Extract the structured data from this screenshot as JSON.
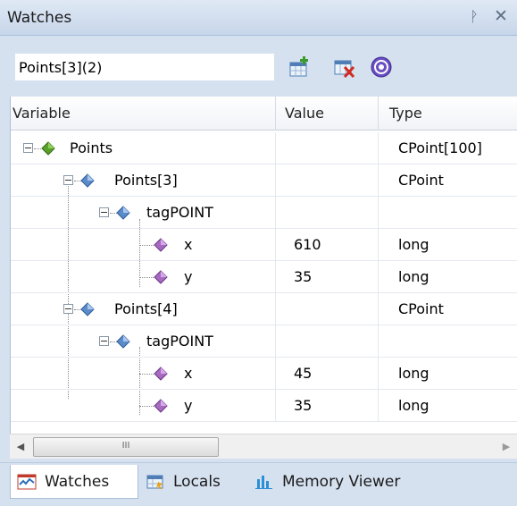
{
  "window": {
    "title": "Watches",
    "pin_glyph": "ᚹ",
    "close_glyph": "✕"
  },
  "toolbar": {
    "expression_value": "Points[3](2)",
    "buttons": [
      {
        "icon": "add-watch-icon"
      },
      {
        "icon": "delete-watch-icon"
      },
      {
        "icon": "help-icon"
      }
    ]
  },
  "grid": {
    "columns": [
      "Variable",
      "Value",
      "Type"
    ],
    "rows": [
      {
        "name": "Points",
        "value": "",
        "type": "CPoint[100]",
        "icon": "green-diamond-icon",
        "expander": "minus"
      },
      {
        "name": "Points[3]",
        "value": "",
        "type": "CPoint",
        "icon": "blue-diamond-icon",
        "expander": "minus"
      },
      {
        "name": "tagPOINT",
        "value": "",
        "type": "",
        "icon": "blue-diamond-icon",
        "expander": "minus"
      },
      {
        "name": "x",
        "value": "610",
        "type": "long",
        "icon": "purple-diamond-icon",
        "expander": ""
      },
      {
        "name": "y",
        "value": "35",
        "type": "long",
        "icon": "purple-diamond-icon",
        "expander": ""
      },
      {
        "name": "Points[4]",
        "value": "",
        "type": "CPoint",
        "icon": "blue-diamond-icon",
        "expander": "minus"
      },
      {
        "name": "tagPOINT",
        "value": "",
        "type": "",
        "icon": "blue-diamond-icon",
        "expander": "minus"
      },
      {
        "name": "x",
        "value": "45",
        "type": "long",
        "icon": "purple-diamond-icon",
        "expander": ""
      },
      {
        "name": "y",
        "value": "35",
        "type": "long",
        "icon": "purple-diamond-icon",
        "expander": ""
      }
    ]
  },
  "scrollbar": {
    "left_arrow": "◀",
    "right_arrow": "▶",
    "thumb_grip": "III"
  },
  "tabs": [
    {
      "label": "Watches",
      "icon": "watches-tab-icon",
      "active": true
    },
    {
      "label": "Locals",
      "icon": "locals-tab-icon",
      "active": false
    },
    {
      "label": "Memory Viewer",
      "icon": "memory-viewer-tab-icon",
      "active": false
    }
  ],
  "colors": {
    "panel_bg": "#d6e1f0",
    "green_diamond": "#5aa02c",
    "blue_diamond": "#5b8cc9",
    "purple_diamond": "#a66bbf"
  }
}
